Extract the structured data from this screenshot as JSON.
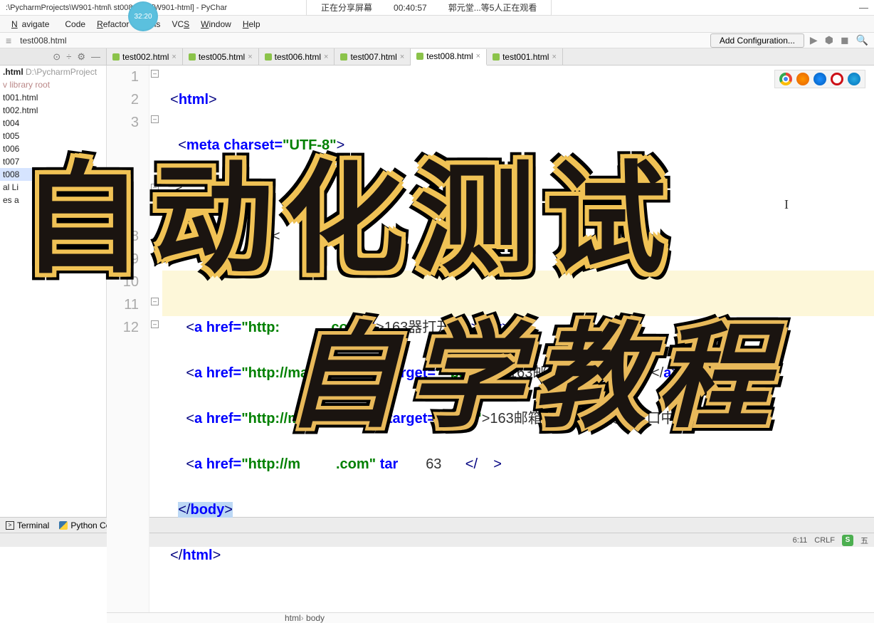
{
  "titlebar": {
    "path": ":\\PycharmProjects\\W901-html\\      st008.html [W901-html] - PyChar"
  },
  "clock": {
    "time": "32:20"
  },
  "share": {
    "sharing": "正在分享屏幕",
    "duration": "00:40:57",
    "watchers": "郭元堂...等5人正在观看"
  },
  "menu": {
    "navigate": "Navigate",
    "code": "Code",
    "refactor": "Refactor",
    "tools": "Tools",
    "vcs": "VCS",
    "window": "Window",
    "help": "Help"
  },
  "navbar": {
    "crumb_icon": "≡",
    "crumb_file": "test008.html",
    "add_config": "Add Configuration..."
  },
  "tabs": [
    {
      "label": "test002.html"
    },
    {
      "label": "test005.html"
    },
    {
      "label": "test006.html"
    },
    {
      "label": "test007.html"
    },
    {
      "label": "test008.html",
      "active": true
    },
    {
      "label": "test001.html"
    }
  ],
  "tree": {
    "root": ".html",
    "root_path": "D:\\PycharmProject",
    "lib": "library root",
    "items": [
      "t001.html",
      "t002.html",
      "t004",
      "t005",
      "t006",
      "t007",
      "t008"
    ]
  },
  "code": {
    "lines": [
      "1",
      "2",
      "3",
      "",
      "",
      "",
      "",
      "8",
      "9",
      "10",
      "11",
      "12"
    ],
    "l1_open": "<",
    "l1_tag": "html",
    "l1_close": ">",
    "l2_open": "<",
    "l2_tag": "meta",
    "l2_attr": " charset=",
    "l2_val": "\"UTF-8\"",
    "l2_close": ">",
    "l3_raw": "   <",
    "l4_raw": "          >文            <     >",
    "l7_a": "<",
    "l7_tag": "a",
    "l7_href": " href=",
    "l7_url": "\"http:            .com\"",
    "l7_t": " t",
    "l7_txt": ">163",
    "l7_end": "器打开</",
    "l7_ea": "a",
    "l7_eb": "><",
    "l7_br": "br",
    "l7_ec": ">",
    "l8_a": "<",
    "l8_tag": "a",
    "l8_href": " href=",
    "l8_url": "\"http://mail.163.com\"",
    "l8_tgt": " target=",
    "l8_tval": "\"_parent\"",
    "l8_txt": ">163邮箱-在父窗口打开</",
    "l8_ea": "a",
    "l8_eb": "><",
    "l8_br": "br",
    "l8_ec": ">",
    "l9_a": "<",
    "l9_tag": "a",
    "l9_href": " href=",
    "l9_url": "\"http://mail.163.com\"",
    "l9_tgt": " target=",
    "l9_tval": "\"_self\"",
    "l9_txt": ">163邮箱-在同一框架或窗口中打开</",
    "l9_ea": "a",
    "l9_eb": "><",
    "l9_br": "b",
    "l10_a": "<",
    "l10_tag": "a",
    "l10_href": " href=",
    "l10_url": "\"http://m         .com\"",
    "l10_tgt": " tar",
    "l10_txt": "63",
    "l10_end": "</    >",
    "l11_open": "</",
    "l11_tag": "body",
    "l11_close": ">",
    "l12_open": "</",
    "l12_tag": "html",
    "l12_close": ">"
  },
  "breadcrumb": {
    "a": "html",
    "b": "body"
  },
  "bottom": {
    "terminal": "Terminal",
    "pyconsole": "Python Console"
  },
  "status": {
    "pos": "6:11",
    "crlf": "CRLF",
    "ime": "五"
  },
  "overlay": {
    "t1": "自动化测试",
    "t2": "自学教程"
  }
}
